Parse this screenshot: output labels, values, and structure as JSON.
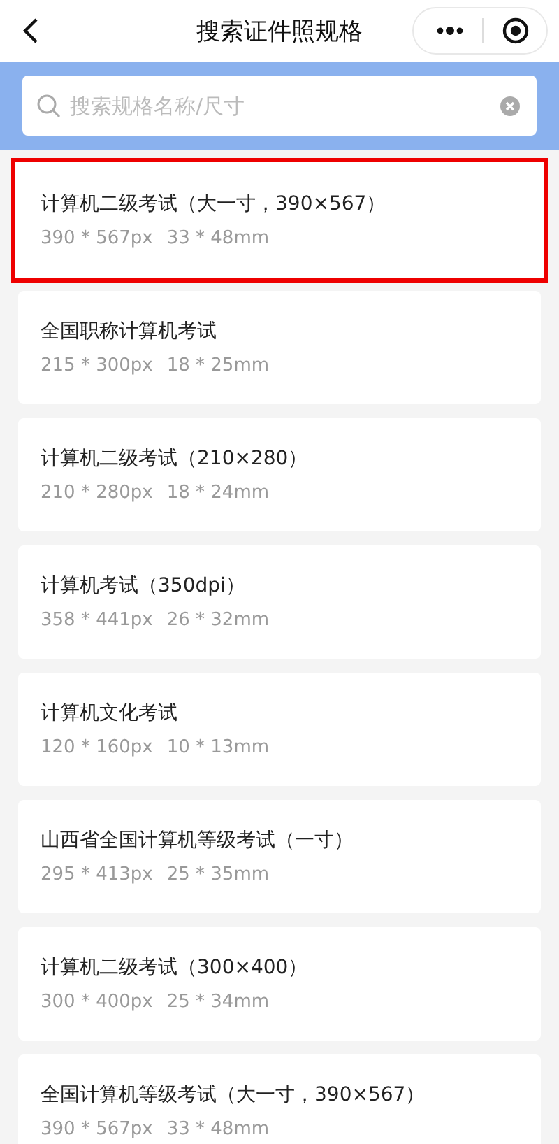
{
  "nav_bar": {
    "title": "搜索证件照规格"
  },
  "search": {
    "placeholder": "搜索规格名称/尺寸"
  },
  "specs": [
    {
      "name": "计算机二级考试（大一寸，390×567）",
      "pixels": "390 * 567px",
      "size": "33 * 48mm",
      "selected": true
    },
    {
      "name": "全国职称计算机考试",
      "pixels": "215 * 300px",
      "size": "18 * 25mm",
      "selected": false
    },
    {
      "name": "计算机二级考试（210×280）",
      "pixels": "210 * 280px",
      "size": "18 * 24mm",
      "selected": false
    },
    {
      "name": "计算机考试（350dpi）",
      "pixels": "358 * 441px",
      "size": "26 * 32mm",
      "selected": false
    },
    {
      "name": "计算机文化考试",
      "pixels": "120 * 160px",
      "size": "10 * 13mm",
      "selected": false
    },
    {
      "name": "山西省全国计算机等级考试（一寸）",
      "pixels": "295 * 413px",
      "size": "25 * 35mm",
      "selected": false
    },
    {
      "name": "计算机二级考试（300×400）",
      "pixels": "300 * 400px",
      "size": "25 * 34mm",
      "selected": false
    },
    {
      "name": "全国计算机等级考试（大一寸，390×567）",
      "pixels": "390 * 567px",
      "size": "33 * 48mm",
      "selected": false
    }
  ]
}
